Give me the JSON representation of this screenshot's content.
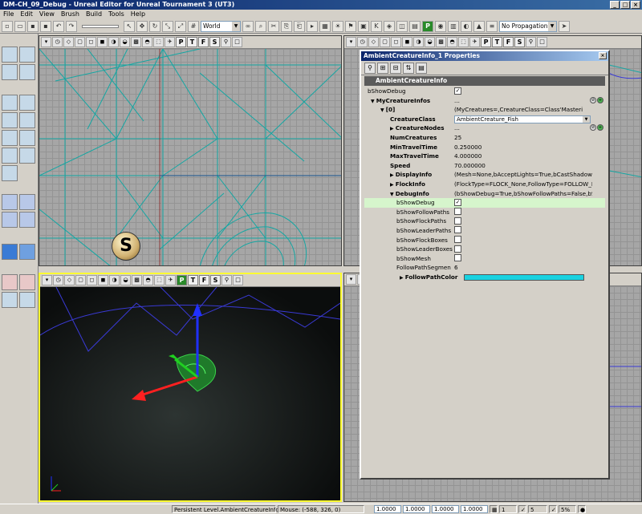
{
  "window": {
    "title": "DM-CH_09_Debug - Unreal Editor for Unreal Tournament 3 (UT3)",
    "btn_min": "_",
    "btn_max": "□",
    "btn_close": "×"
  },
  "menu": [
    "File",
    "Edit",
    "View",
    "Brush",
    "Build",
    "Tools",
    "Help"
  ],
  "toolbar": {
    "coord_system": "World",
    "propagation": "No Propagation"
  },
  "viewport_buttons": [
    "P",
    "T",
    "F",
    "S"
  ],
  "properties": {
    "title": "AmbientCreatureInfo_1 Properties",
    "close": "×",
    "category": "AmbientCreatureInfo",
    "rows": [
      {
        "name": "bShowDebug",
        "value": "",
        "checkbox": true,
        "checked": true
      },
      {
        "name": "MyCreatureInfos",
        "value": "...",
        "expander": "open"
      },
      {
        "name": "[0]",
        "value": "(MyCreatures=,CreatureClass=Class'Masteri",
        "expander": "open"
      },
      {
        "name": "CreatureClass",
        "value": "AmbientCreature_Fish",
        "combo": true
      },
      {
        "name": "CreatureNodes",
        "value": "...",
        "expander": "closed"
      },
      {
        "name": "NumCreatures",
        "value": "25"
      },
      {
        "name": "MinTravelTime",
        "value": "0.250000"
      },
      {
        "name": "MaxTravelTime",
        "value": "4.000000"
      },
      {
        "name": "Speed",
        "value": "70.000000"
      },
      {
        "name": "DisplayInfo",
        "value": "(Mesh=None,bAcceptLights=True,bCastShadows=Fa",
        "expander": "closed"
      },
      {
        "name": "FlockInfo",
        "value": "(FlockType=FLOCK_None,FollowType=FOLLOW_None",
        "expander": "closed"
      },
      {
        "name": "DebugInfo",
        "value": "(bShowDebug=True,bShowFollowPaths=False,bShow",
        "expander": "open"
      },
      {
        "name": "bShowDebug",
        "value": "",
        "checkbox": true,
        "checked": true,
        "highlight": true
      },
      {
        "name": "bShowFollowPaths",
        "value": "",
        "checkbox": true,
        "checked": false
      },
      {
        "name": "bShowFlockPaths",
        "value": "",
        "checkbox": true,
        "checked": false
      },
      {
        "name": "bShowLeaderPaths",
        "value": "",
        "checkbox": true,
        "checked": false
      },
      {
        "name": "bShowFlockBoxes",
        "value": "",
        "checkbox": true,
        "checked": false
      },
      {
        "name": "bShowLeaderBoxes",
        "value": "",
        "checkbox": true,
        "checked": false
      },
      {
        "name": "bShowMesh",
        "value": "",
        "checkbox": true,
        "checked": false
      },
      {
        "name": "FollowPathSegmen",
        "value": "6"
      },
      {
        "name": "FollowPathColor",
        "value": "",
        "color": "#19d2e0",
        "expander": "closed"
      }
    ]
  },
  "status": {
    "level": "Persistent Level.AmbientCreatureInfo_1",
    "mouse": "Mouse: (-588, 326, 0)",
    "drag_x": "1.0000",
    "drag_y": "1.0000",
    "drag_z": "1.0000",
    "scale": "1.0000",
    "grid": "1",
    "rot": "5",
    "pct": "5%"
  },
  "colors": {
    "wire": "#13a7a3",
    "selected_viewport": "#ffff30",
    "brush_blue": "#3a3ad6"
  }
}
